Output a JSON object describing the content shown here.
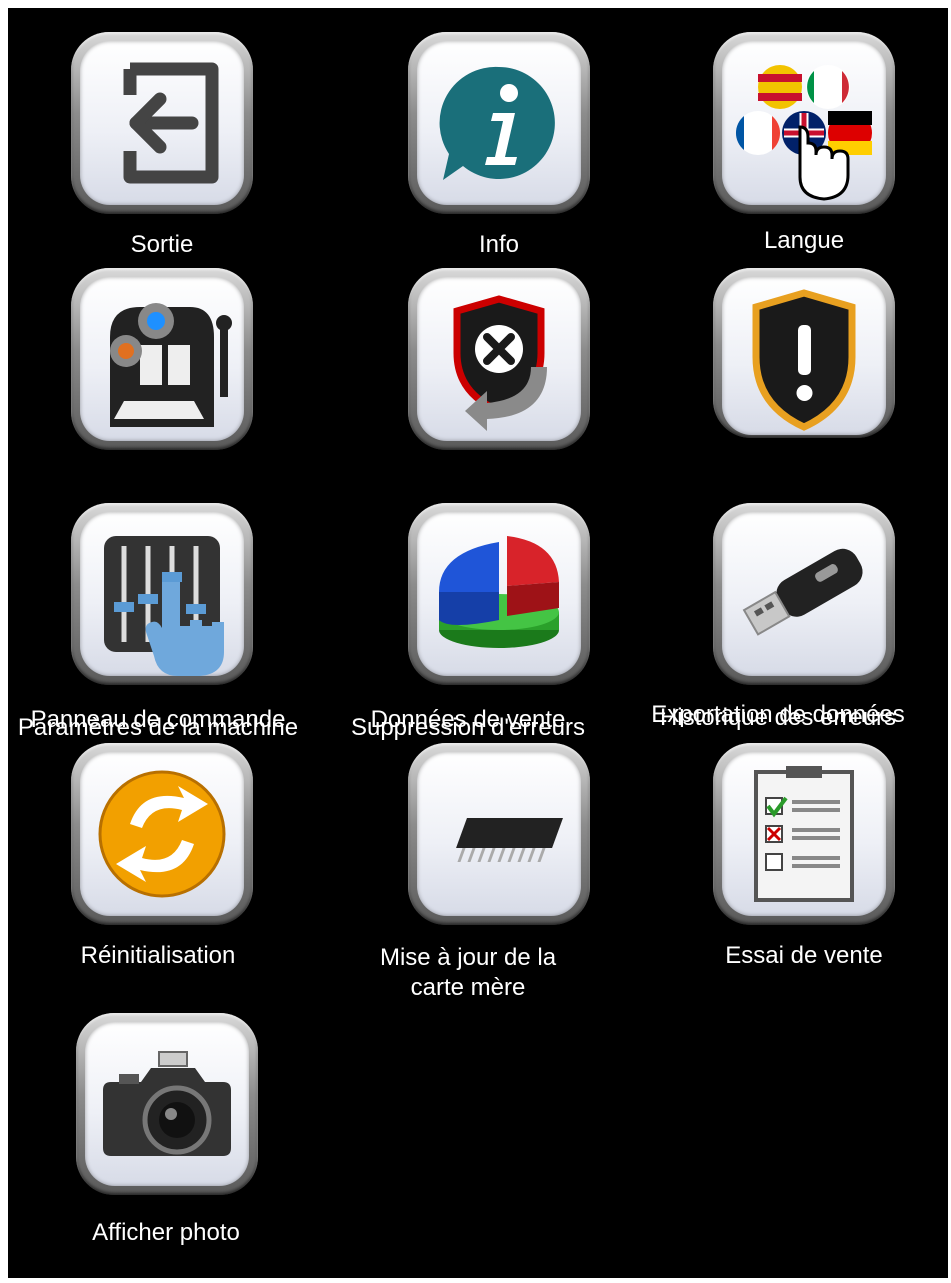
{
  "menu": {
    "items": [
      {
        "label": "Sortie",
        "icon": "exit-icon"
      },
      {
        "label": "Info",
        "icon": "info-icon"
      },
      {
        "label": "Langue",
        "icon": "language-flags-icon"
      },
      {
        "label": "Paramètres de la machine",
        "icon": "machine-settings-icon"
      },
      {
        "label": "Suppression d'erreurs",
        "icon": "error-clear-icon"
      },
      {
        "label": "Historique des erreurs",
        "icon": "error-history-icon"
      },
      {
        "label": "Panneau de commande",
        "icon": "control-panel-icon"
      },
      {
        "label": "Données de vente",
        "icon": "sales-chart-icon"
      },
      {
        "label": "Exportation de données",
        "icon": "usb-drive-icon"
      },
      {
        "label": "Réinitialisation",
        "icon": "reset-icon"
      },
      {
        "label_line1": "Mise à jour de la",
        "label_line2": "carte mère",
        "icon": "chip-icon"
      },
      {
        "label": "Essai de vente",
        "icon": "checklist-icon"
      },
      {
        "label": "Afficher photo",
        "icon": "camera-icon"
      }
    ]
  },
  "colors": {
    "background": "#000000",
    "text": "#ffffff",
    "button_frame": "#8c8c8c"
  }
}
